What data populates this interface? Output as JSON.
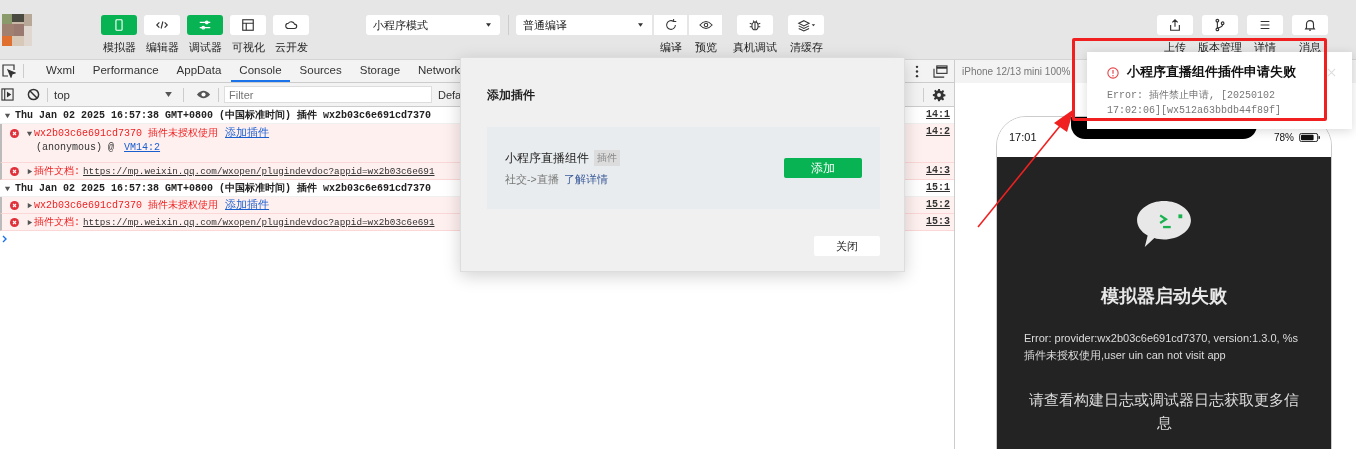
{
  "toolbar": {
    "views": [
      {
        "label": "模拟器",
        "selected": true
      },
      {
        "label": "编辑器",
        "selected": false
      },
      {
        "label": "调试器",
        "selected": true
      },
      {
        "label": "可视化",
        "selected": false
      },
      {
        "label": "云开发",
        "selected": false
      }
    ],
    "mode_select": "小程序模式",
    "compile_select": "普通编译",
    "actions": [
      {
        "label": "编译"
      },
      {
        "label": "预览"
      },
      {
        "label": "真机调试"
      },
      {
        "label": "清缓存"
      }
    ],
    "right_buttons": [
      {
        "label": "上传"
      },
      {
        "label": "版本管理"
      },
      {
        "label": "详情"
      },
      {
        "label": "消息"
      }
    ]
  },
  "devtools": {
    "tabs": [
      {
        "label": "Wxml",
        "selected": false
      },
      {
        "label": "Performance",
        "selected": false
      },
      {
        "label": "AppData",
        "selected": false
      },
      {
        "label": "Console",
        "selected": true
      },
      {
        "label": "Sources",
        "selected": false
      },
      {
        "label": "Storage",
        "selected": false
      },
      {
        "label": "Network",
        "selected": false
      }
    ],
    "context": "top",
    "filter": {
      "placeholder": "Filter"
    },
    "levels": "Defa",
    "logs": [
      {
        "kind": "group",
        "expanded": true,
        "text": "Thu Jan 02 2025 16:57:38 GMT+0800 (中国标准时间) 插件 wx2b03c6e691cd7370",
        "location": "14:1"
      },
      {
        "kind": "error",
        "expanded": true,
        "id": "wx2b03c6e691cd7370",
        "message": "插件未授权使用",
        "link": "添加插件",
        "caller": "(anonymous) @",
        "caller_link": "VM14:2",
        "location": "14:2"
      },
      {
        "kind": "doc",
        "expanded": false,
        "label": "插件文档:",
        "url": "https://mp.weixin.qq.com/wxopen/plugindevdoc?appid=wx2b03c6e691",
        "location": "14:3"
      },
      {
        "kind": "group",
        "expanded": true,
        "text": "Thu Jan 02 2025 16:57:38 GMT+0800 (中国标准时间) 插件 wx2b03c6e691cd7370",
        "location": "15:1"
      },
      {
        "kind": "error",
        "expanded": false,
        "id": "wx2b03c6e691cd7370",
        "message": "插件未授权使用",
        "link": "添加插件",
        "location": "15:2"
      },
      {
        "kind": "doc",
        "expanded": false,
        "label": "插件文档:",
        "url": "https://mp.weixin.qq.com/wxopen/plugindevdoc?appid=wx2b03c6e691",
        "location": "15:3"
      }
    ]
  },
  "dialog": {
    "title": "添加插件",
    "plugin": {
      "name": "小程序直播组件",
      "tag": "插件",
      "category": "社交->直播",
      "link": "了解详情"
    },
    "add_button": "添加",
    "close_button": "关闭"
  },
  "simulator": {
    "device": "iPhone 12/13 mini 100%",
    "time": "17:01",
    "battery": "78%",
    "title": "模拟器启动失败",
    "error": "Error: provider:wx2b03c6e691cd7370, version:1.3.0, %s 插件未授权使用,user uin can not visit app",
    "hint": "请查看构建日志或调试器日志获取更多信息"
  },
  "notification": {
    "title": "小程序直播组件插件申请失败",
    "message": "Error: 插件禁止申请, [20250102 17:02:06][wx512a63bbdb44f89f]"
  }
}
